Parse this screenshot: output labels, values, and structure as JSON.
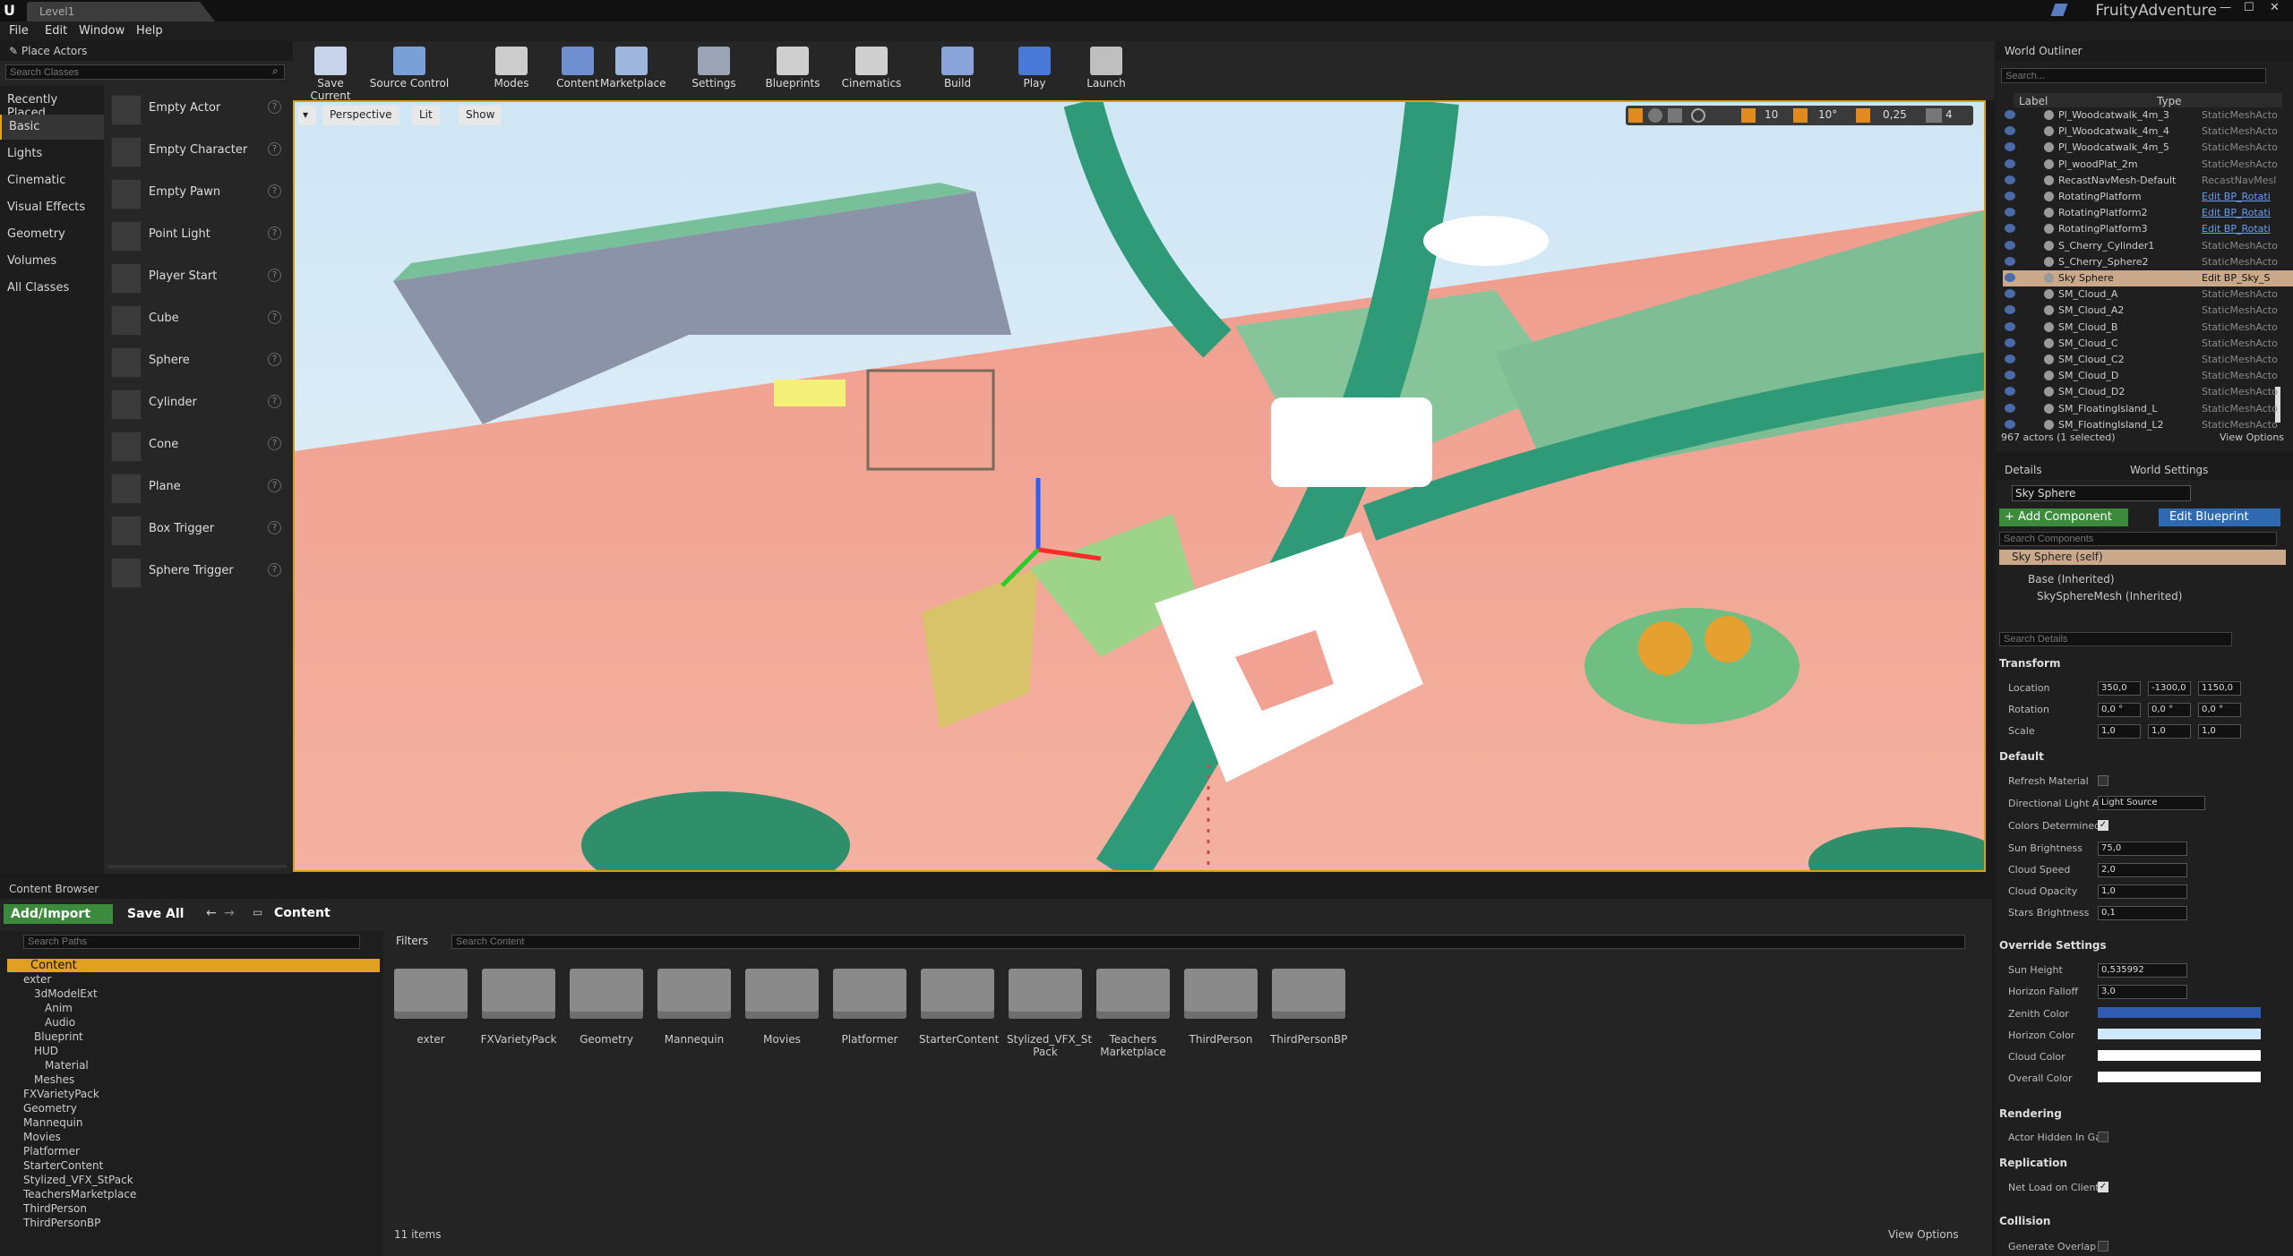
{
  "window": {
    "tab": "Level1",
    "app_title": "FruityAdventure"
  },
  "menu": [
    "File",
    "Edit",
    "Window",
    "Help"
  ],
  "place_actors": {
    "title": "Place Actors",
    "search_placeholder": "Search Classes",
    "categories": [
      "Recently Placed",
      "Basic",
      "Lights",
      "Cinematic",
      "Visual Effects",
      "Geometry",
      "Volumes",
      "All Classes"
    ],
    "items": [
      "Empty Actor",
      "Empty Character",
      "Empty Pawn",
      "Point Light",
      "Player Start",
      "Cube",
      "Sphere",
      "Cylinder",
      "Cone",
      "Plane",
      "Box Trigger",
      "Sphere Trigger"
    ]
  },
  "toolbar": [
    "Save Current",
    "Source Control",
    "Modes",
    "Content",
    "Marketplace",
    "Settings",
    "Blueprints",
    "Cinematics",
    "Build",
    "Play",
    "Launch"
  ],
  "viewport": {
    "perspective": "Perspective",
    "lit": "Lit",
    "show": "Show",
    "grid": "10",
    "angle": "10°",
    "scale": "0,25",
    "cam_speed": "4"
  },
  "outliner": {
    "title": "World Outliner",
    "search_placeholder": "Search...",
    "col_label": "Label",
    "col_type": "Type",
    "rows": [
      {
        "n": "Pl_Woodcatwalk_4m_3",
        "t": "StaticMeshActo"
      },
      {
        "n": "Pl_Woodcatwalk_4m_4",
        "t": "StaticMeshActo"
      },
      {
        "n": "Pl_Woodcatwalk_4m_5",
        "t": "StaticMeshActo"
      },
      {
        "n": "Pl_woodPlat_2m",
        "t": "StaticMeshActo"
      },
      {
        "n": "RecastNavMesh-Default",
        "t": "RecastNavMesl"
      },
      {
        "n": "RotatingPlatform",
        "t": "Edit BP_Rotati"
      },
      {
        "n": "RotatingPlatform2",
        "t": "Edit BP_Rotati"
      },
      {
        "n": "RotatingPlatform3",
        "t": "Edit BP_Rotati"
      },
      {
        "n": "S_Cherry_Cylinder1",
        "t": "StaticMeshActo"
      },
      {
        "n": "S_Cherry_Sphere2",
        "t": "StaticMeshActo"
      },
      {
        "n": "Sky Sphere",
        "t": "Edit BP_Sky_S"
      },
      {
        "n": "SM_Cloud_A",
        "t": "StaticMeshActo"
      },
      {
        "n": "SM_Cloud_A2",
        "t": "StaticMeshActo"
      },
      {
        "n": "SM_Cloud_B",
        "t": "StaticMeshActo"
      },
      {
        "n": "SM_Cloud_C",
        "t": "StaticMeshActo"
      },
      {
        "n": "SM_Cloud_C2",
        "t": "StaticMeshActo"
      },
      {
        "n": "SM_Cloud_D",
        "t": "StaticMeshActo"
      },
      {
        "n": "SM_Cloud_D2",
        "t": "StaticMeshActo"
      },
      {
        "n": "SM_FloatingIsland_L",
        "t": "StaticMeshActo"
      },
      {
        "n": "SM_FloatingIsland_L2",
        "t": "StaticMeshActo"
      }
    ],
    "selected": "Sky Sphere",
    "footer": "967 actors (1 selected)",
    "view_options": "View Options"
  },
  "details": {
    "tab_details": "Details",
    "tab_world": "World Settings",
    "name": "Sky Sphere",
    "add_component": "+ Add Component",
    "edit_blueprint": "Edit Blueprint",
    "search_components": "Search Components",
    "self": "Sky Sphere (self)",
    "base": "Base (Inherited)",
    "mesh": "SkySphereMesh (Inherited)",
    "search_details": "Search Details",
    "transform": "Transform",
    "location_label": "Location",
    "location": [
      "350,0",
      "-1300,0",
      "1150,0"
    ],
    "rotation_label": "Rotation",
    "rotation": [
      "0,0 °",
      "0,0 °",
      "0,0 °"
    ],
    "scale_label": "Scale",
    "scale": [
      "1,0",
      "1,0",
      "1,0"
    ],
    "default": "Default",
    "refresh_material": "Refresh Material",
    "directional_light": "Directional Light A",
    "light_source": "Light Source",
    "colors_determined": "Colors Determined",
    "sun_brightness": "Sun Brightness",
    "sun_brightness_v": "75,0",
    "cloud_speed": "Cloud Speed",
    "cloud_speed_v": "2,0",
    "cloud_opacity": "Cloud Opacity",
    "cloud_opacity_v": "1,0",
    "stars_brightness": "Stars Brightness",
    "stars_brightness_v": "0,1",
    "override": "Override Settings",
    "sun_height": "Sun Height",
    "sun_height_v": "0,535992",
    "horizon_falloff": "Horizon Falloff",
    "horizon_falloff_v": "3,0",
    "zenith": "Zenith Color",
    "horizon": "Horizon Color",
    "cloud_color": "Cloud Color",
    "overall": "Overall Color",
    "rendering": "Rendering",
    "actor_hidden": "Actor Hidden In Ga",
    "replication": "Replication",
    "net_load": "Net Load on Client",
    "collision": "Collision",
    "generate_overlap": "Generate Overlap E"
  },
  "content_browser": {
    "title": "Content Browser",
    "add_import": "Add/Import",
    "save_all": "Save All",
    "path": "Content",
    "search_paths": "Search Paths",
    "filters": "Filters",
    "search_content": "Search Content",
    "tree": [
      "Content",
      "exter",
      "3dModelExt",
      "Anim",
      "Audio",
      "Blueprint",
      "HUD",
      "Material",
      "Meshes",
      "FXVarietyPack",
      "Geometry",
      "Mannequin",
      "Movies",
      "Platformer",
      "StarterContent",
      "Stylized_VFX_StPack",
      "TeachersMarketplace",
      "ThirdPerson",
      "ThirdPersonBP"
    ],
    "folders": [
      "exter",
      "FXVarietyPack",
      "Geometry",
      "Mannequin",
      "Movies",
      "Platformer",
      "StarterContent",
      "Stylized_VFX_St Pack",
      "Teachers Marketplace",
      "ThirdPerson",
      "ThirdPersonBP"
    ],
    "count": "11 items",
    "view_options": "View Options"
  }
}
